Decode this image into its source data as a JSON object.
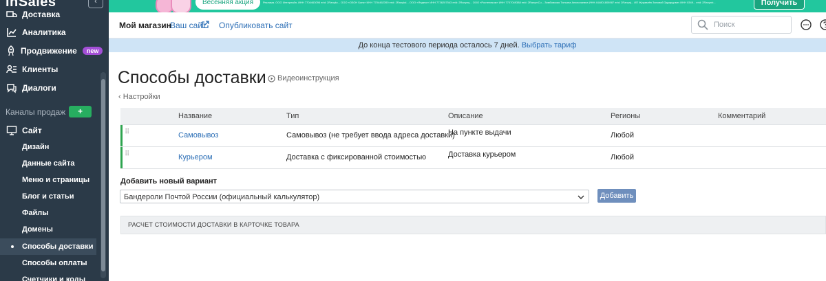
{
  "sidebar": {
    "logo": "inSales",
    "collapse_icon": "‹",
    "items": [
      {
        "label": "Доставка",
        "icon": "truck-icon"
      },
      {
        "label": "Аналитика",
        "icon": "chart-icon"
      },
      {
        "label": "Продвижение",
        "icon": "rocket-icon",
        "badge": "new"
      },
      {
        "label": "Клиенты",
        "icon": "users-icon"
      },
      {
        "label": "Диалоги",
        "icon": "chat-icon"
      }
    ],
    "section_title": "Каналы продаж",
    "section_add": "+",
    "site_label": "Сайт",
    "sub_items": [
      {
        "label": "Дизайн"
      },
      {
        "label": "Данные сайта"
      },
      {
        "label": "Меню и страницы"
      },
      {
        "label": "Блог и статьи"
      },
      {
        "label": "Файлы"
      },
      {
        "label": "Домены"
      },
      {
        "label": "Способы доставки",
        "active": true
      },
      {
        "label": "Способы оплаты"
      },
      {
        "label": "Счетчики и коды"
      }
    ]
  },
  "banner": {
    "promo_button": "Весенняя акция",
    "legal_text": "Реклама. ООО Интерлайн, ИНН 7704463096 erid: 2Ranykc... ООО «ОЗОН Банк» ИНН 7704462390 erid: 2Ranykd... ООО «Яндекс» ИНН 7736207543 erid: 2Ranynq... ООО «Ростелеком» ИНН 7707049388 erid: 2RanymCu... Зимбовская Татьяна Анатольевна ИНН 444801808987 erid: 2Ranynj... ИП Журавлёв Зиновий Эдуардович ИНН 0349... erid: 2Ranynb...",
    "get_button": "Получить"
  },
  "topbar": {
    "my_store": "Мой магазин",
    "your_site": "Ваш сайт",
    "publish": "Опубликовать сайт",
    "search_placeholder": "Поиск"
  },
  "notice": {
    "text": "До конца тестового периода осталось 7 дней.",
    "link": "Выбрать тариф"
  },
  "page": {
    "title": "Способы доставки",
    "video_link": "Видеоинструкция",
    "back_link": "Настройки"
  },
  "table": {
    "headers": [
      "Название",
      "Тип",
      "Описание",
      "Регионы",
      "Комментарий"
    ],
    "rows": [
      {
        "name": "Самовывоз",
        "type": "Самовывоз (не требует ввода адреса доставки)",
        "description": "На пункте выдачи",
        "regions": "Любой",
        "comment": ""
      },
      {
        "name": "Курьером",
        "type": "Доставка с фиксированной стоимостью",
        "description": "Доставка курьером",
        "regions": "Любой",
        "comment": ""
      }
    ]
  },
  "add_variant": {
    "label": "Добавить новый вариант",
    "selected": "Бандероли Почтой России (официальный калькулятор)",
    "button": "Добавить"
  },
  "calc_panel": {
    "title": "РАСЧЕТ СТОИМОСТИ ДОСТАВКИ В КАРТОЧКЕ ТОВАРА"
  },
  "colors": {
    "sidebar_bg": "#2b3a48",
    "banner_bg": "#22c79e",
    "link": "#2a6db5",
    "active_bar": "#2ea44f",
    "badge_new": "#a34fd6",
    "add_button": "#6f8fbd",
    "notice_bg": "#cfe4f6"
  }
}
